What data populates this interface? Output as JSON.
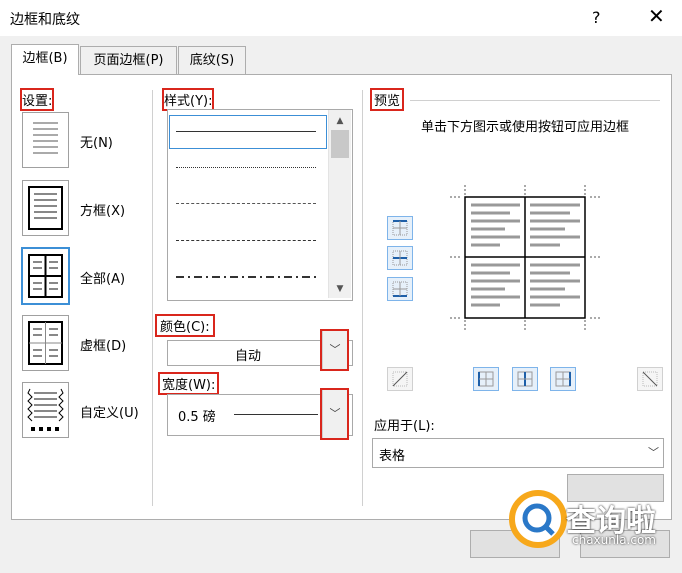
{
  "window": {
    "title": "边框和底纹",
    "help": "?",
    "close": "✕"
  },
  "tabs": [
    {
      "label": "边框(B)",
      "active": true
    },
    {
      "label": "页面边框(P)",
      "active": false
    },
    {
      "label": "底纹(S)",
      "active": false
    }
  ],
  "settings": {
    "label": "设置:",
    "items": [
      {
        "label": "无(N)"
      },
      {
        "label": "方框(X)"
      },
      {
        "label": "全部(A)",
        "selected": true
      },
      {
        "label": "虚框(D)"
      },
      {
        "label": "自定义(U)"
      }
    ]
  },
  "style": {
    "label": "样式(Y):"
  },
  "color": {
    "label": "颜色(C):",
    "value": "自动"
  },
  "width": {
    "label": "宽度(W):",
    "value": "0.5 磅"
  },
  "preview": {
    "label": "预览",
    "hint": "单击下方图示或使用按钮可应用边框",
    "apply_label": "应用于(L):",
    "apply_value": "表格"
  },
  "watermark": {
    "text": "查询啦",
    "url": "chaxunla.com"
  },
  "colors": {
    "highlight": "#d9261c",
    "accent": "#3c8fd6"
  }
}
